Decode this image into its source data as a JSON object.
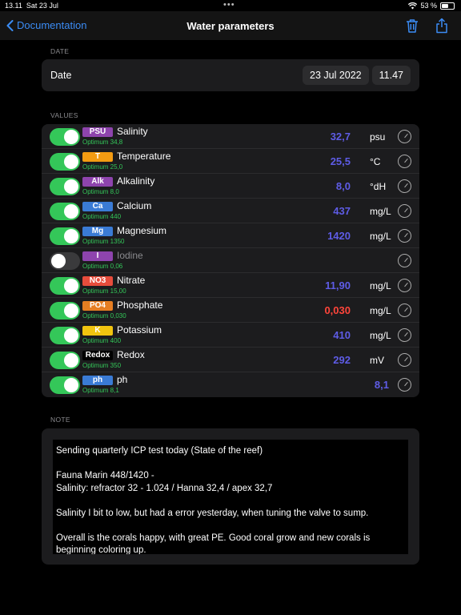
{
  "status": {
    "time": "13.11",
    "date": "Sat 23 Jul",
    "battery": "53 %",
    "battery_level": 0.53
  },
  "nav": {
    "back_label": "Documentation",
    "title": "Water parameters"
  },
  "date_section": {
    "header": "DATE",
    "label": "Date",
    "date_value": "23 Jul 2022",
    "time_value": "11.47"
  },
  "values_section": {
    "header": "VALUES",
    "params": [
      {
        "badge": "PSU",
        "badge_color": "#8e44ad",
        "name": "Salinity",
        "optimum": "Optimum 34,8",
        "value": "32,7",
        "unit": "psu",
        "enabled": true,
        "value_color": "#5e5ce6"
      },
      {
        "badge": "T",
        "badge_color": "#f39c12",
        "name": "Temperature",
        "optimum": "Optimum 25,0",
        "value": "25,5",
        "unit": "°C",
        "enabled": true,
        "value_color": "#5e5ce6"
      },
      {
        "badge": "Alk",
        "badge_color": "#8e44ad",
        "name": "Alkalinity",
        "optimum": "Optimum 8,0",
        "value": "8,0",
        "unit": "°dH",
        "enabled": true,
        "value_color": "#5e5ce6"
      },
      {
        "badge": "Ca",
        "badge_color": "#3a7bd5",
        "name": "Calcium",
        "optimum": "Optimum 440",
        "value": "437",
        "unit": "mg/L",
        "enabled": true,
        "value_color": "#5e5ce6"
      },
      {
        "badge": "Mg",
        "badge_color": "#3a7bd5",
        "name": "Magnesium",
        "optimum": "Optimum 1350",
        "value": "1420",
        "unit": "mg/L",
        "enabled": true,
        "value_color": "#5e5ce6"
      },
      {
        "badge": "I",
        "badge_color": "#8e44ad",
        "name": "Iodine",
        "optimum": "Optimum 0,06",
        "value": "",
        "unit": "",
        "enabled": false,
        "value_color": "#5e5ce6"
      },
      {
        "badge": "NO3",
        "badge_color": "#e74c3c",
        "name": "Nitrate",
        "optimum": "Optimum 15,00",
        "value": "11,90",
        "unit": "mg/L",
        "enabled": true,
        "value_color": "#5e5ce6"
      },
      {
        "badge": "PO4",
        "badge_color": "#e67e22",
        "name": "Phosphate",
        "optimum": "Optimum 0,030",
        "value": "0,030",
        "unit": "mg/L",
        "enabled": true,
        "value_color": "#ff453a"
      },
      {
        "badge": "K",
        "badge_color": "#f1c40f",
        "name": "Potassium",
        "optimum": "Optimum 400",
        "value": "410",
        "unit": "mg/L",
        "enabled": true,
        "value_color": "#5e5ce6"
      },
      {
        "badge": "Redox",
        "badge_color": "#000000",
        "name": "Redox",
        "optimum": "Optimum 350",
        "value": "292",
        "unit": "mV",
        "enabled": true,
        "value_color": "#5e5ce6"
      },
      {
        "badge": "ph",
        "badge_color": "#3a7bd5",
        "name": "ph",
        "optimum": "Optimum 8,1",
        "value": "8,1",
        "unit": "",
        "enabled": true,
        "value_color": "#5e5ce6"
      }
    ]
  },
  "note_section": {
    "header": "NOTE",
    "lines": [
      "Sending quarterly ICP test today  (State of the reef)",
      "Fauna Marin 448/1420 -",
      "Salinity: refractor 32 - 1.024 / Hanna 32,4 / apex 32,7",
      "Salinity I bit to low, but had a error yesterday, when tuning the valve to sump.",
      "Overall is the corals happy, with great PE. Good coral grow and new corals is beginning coloring up."
    ]
  },
  "colors": {
    "accent": "#3b8cf5",
    "toggle_on": "#34c759",
    "value": "#5e5ce6",
    "value_alert": "#ff453a"
  }
}
